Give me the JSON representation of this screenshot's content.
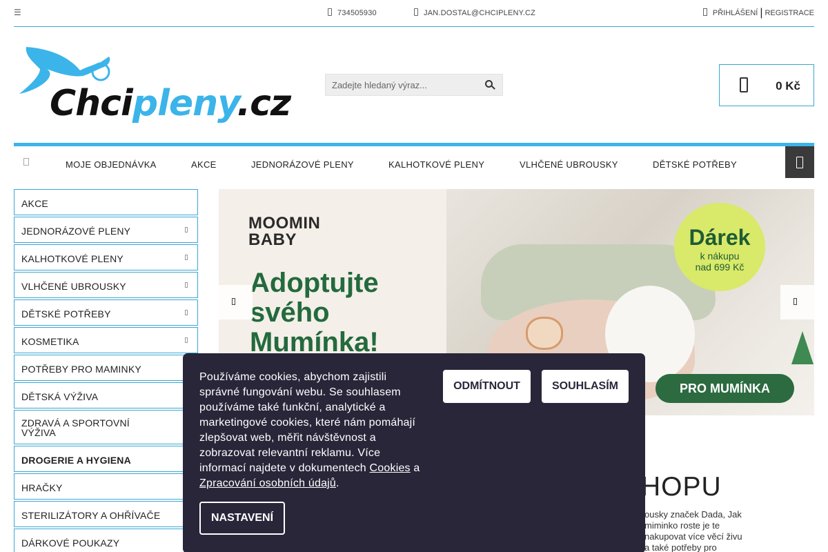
{
  "topbar": {
    "phone": "734505930",
    "email": "JAN.DOSTAL@CHCIPLENY.CZ",
    "login_label": "PŘIHLÁŠENÍ",
    "register_label": "REGISTRACE"
  },
  "logo": {
    "text_dark": "Chci",
    "text_blue": "pleny",
    "text_tld": ".cz"
  },
  "search": {
    "placeholder": "Zadejte hledaný výraz..."
  },
  "cart": {
    "total": "0 Kč"
  },
  "nav": {
    "items": [
      "MOJE OBJEDNÁVKA",
      "AKCE",
      "JEDNORÁZOVÉ PLENY",
      "KALHOTKOVÉ PLENY",
      "VLHČENÉ UBROUSKY",
      "DĚTSKÉ POTŘEBY"
    ]
  },
  "sidebar": {
    "categories": [
      "AKCE",
      "JEDNORÁZOVÉ PLENY",
      "KALHOTKOVÉ PLENY",
      "VLHČENÉ UBROUSKY",
      "DĚTSKÉ POTŘEBY",
      "KOSMETIKA",
      "POTŘEBY PRO MAMINKY",
      "DĚTSKÁ VÝŽIVA",
      "ZDRAVÁ A SPORTOVNÍ VÝŽIVA",
      "DROGERIE A HYGIENA",
      "HRAČKY",
      "STERILIZÁTORY A OHŘÍVAČE",
      "DÁRKOVÉ POUKAZY"
    ]
  },
  "banner": {
    "brand_line1": "MOOMIN",
    "brand_line2": "BABY",
    "headline_line1": "Adoptujte",
    "headline_line2": "svého",
    "headline_line3": "Mumínka!",
    "gift_title": "Dárek",
    "gift_line1": "k nákupu",
    "gift_line2": "nad 699 Kč",
    "cta": "PRO MUMÍNKA"
  },
  "intro": {
    "title_fragment": "HOPU",
    "text_fragment": "ousky značek Dada, Jak miminko roste je te nakupovat více věcí živu a také potřeby pro"
  },
  "cookie": {
    "text": "Používáme cookies, abychom zajistili správné fungování webu. Se souhlasem používáme také funkční, analytické a marketingové cookies, které nám pomáhají zlepšovat web, měřit návštěvnost a zobrazovat relevantní reklamu. Více informací najdete v dokumentech",
    "link_cookies": "Cookies",
    "link_and": "a",
    "link_privacy": "Zpracování osobních údajů",
    "period": ".",
    "reject_label": "ODMÍTNOUT",
    "accept_label": "SOUHLASÍM",
    "settings_label": "NASTAVENÍ"
  }
}
